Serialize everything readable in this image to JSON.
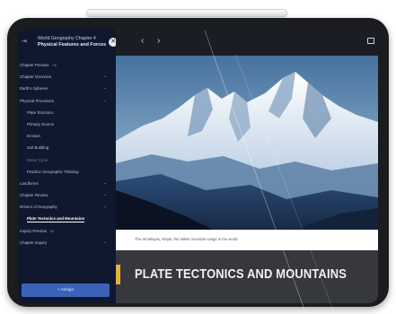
{
  "sidebar": {
    "back_icon": "exit-icon",
    "chapter_title": "World Geography Chapter 4",
    "chapter_subtitle": "Physical Features and Forces",
    "close_icon": "close-icon",
    "items": [
      {
        "label": "Chapter Preview",
        "badge": "06",
        "level": 0,
        "chevron": false
      },
      {
        "label": "Chapter Overview",
        "level": 0,
        "chevron": true
      },
      {
        "label": "Earth's Spheres",
        "level": 0,
        "chevron": true
      },
      {
        "label": "Physical Processes",
        "level": 0,
        "chevron": true
      },
      {
        "label": "Plate Tectonics",
        "level": 1,
        "chevron": false
      },
      {
        "label": "Primary Source",
        "level": 1,
        "chevron": false
      },
      {
        "label": "Erosion",
        "level": 1,
        "chevron": false
      },
      {
        "label": "Soil Building",
        "level": 1,
        "chevron": false
      },
      {
        "label": "Water Cycle",
        "level": 1,
        "chevron": false,
        "dim": true
      },
      {
        "label": "Practice Geographic Thinking",
        "level": 1,
        "chevron": false
      },
      {
        "label": "Landforms",
        "level": 0,
        "chevron": true
      },
      {
        "label": "Chapter Review",
        "level": 0,
        "chevron": true
      },
      {
        "label": "Drivers of Geography",
        "level": 0,
        "chevron": true
      },
      {
        "label": "Plate Tectonics and Mountains",
        "level": 1,
        "chevron": false,
        "active": true
      },
      {
        "label": "Inquiry Preview",
        "badge": "06",
        "level": 0,
        "chevron": false
      },
      {
        "label": "Chapter Inquiry",
        "level": 0,
        "chevron": true
      }
    ],
    "button_label": "+ Assign"
  },
  "topbar": {
    "prev_icon": "chevron-left-icon",
    "next_icon": "chevron-right-icon",
    "fullscreen_icon": "screen-icon"
  },
  "content": {
    "caption": "The Himalayas, Nepal, the tallest mountain range in the world.",
    "section_title": "PLATE TECTONICS AND MOUNTAINS"
  },
  "colors": {
    "sidebar_bg": "#101830",
    "accent_button": "#3a63b8",
    "title_band": "#36383d",
    "title_accent": "#e0b43a"
  }
}
